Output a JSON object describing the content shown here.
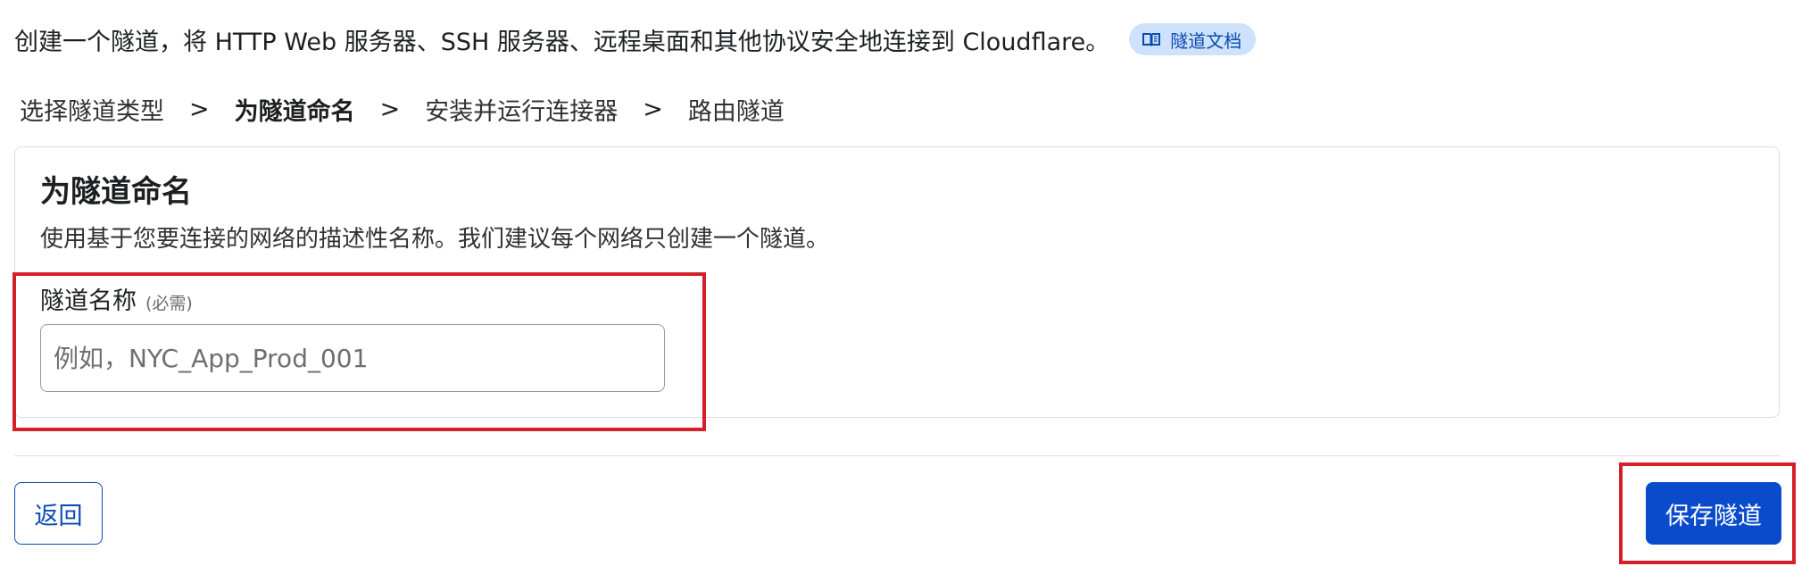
{
  "intro": {
    "text": "创建一个隧道，将 HTTP Web 服务器、SSH 服务器、远程桌面和其他协议安全地连接到 Cloudflare。",
    "doc_link_label": "隧道文档",
    "doc_link_icon": "book-icon"
  },
  "steps": {
    "items": [
      "选择隧道类型",
      "为隧道命名",
      "安装并运行连接器",
      "路由隧道"
    ],
    "separator": ">",
    "active_index": 1
  },
  "card": {
    "title": "为隧道命名",
    "description": "使用基于您要连接的网络的描述性名称。我们建议每个网络只创建一个隧道。",
    "field_label": "隧道名称",
    "field_required": "(必需)",
    "input_value": "",
    "input_placeholder": "例如，NYC_App_Prod_001"
  },
  "footer": {
    "back_label": "返回",
    "save_label": "保存隧道"
  },
  "colors": {
    "accent": "#0a4bcc",
    "link": "#0a4bb1",
    "highlight": "#d42129",
    "pill_bg": "#cfe2fb"
  }
}
